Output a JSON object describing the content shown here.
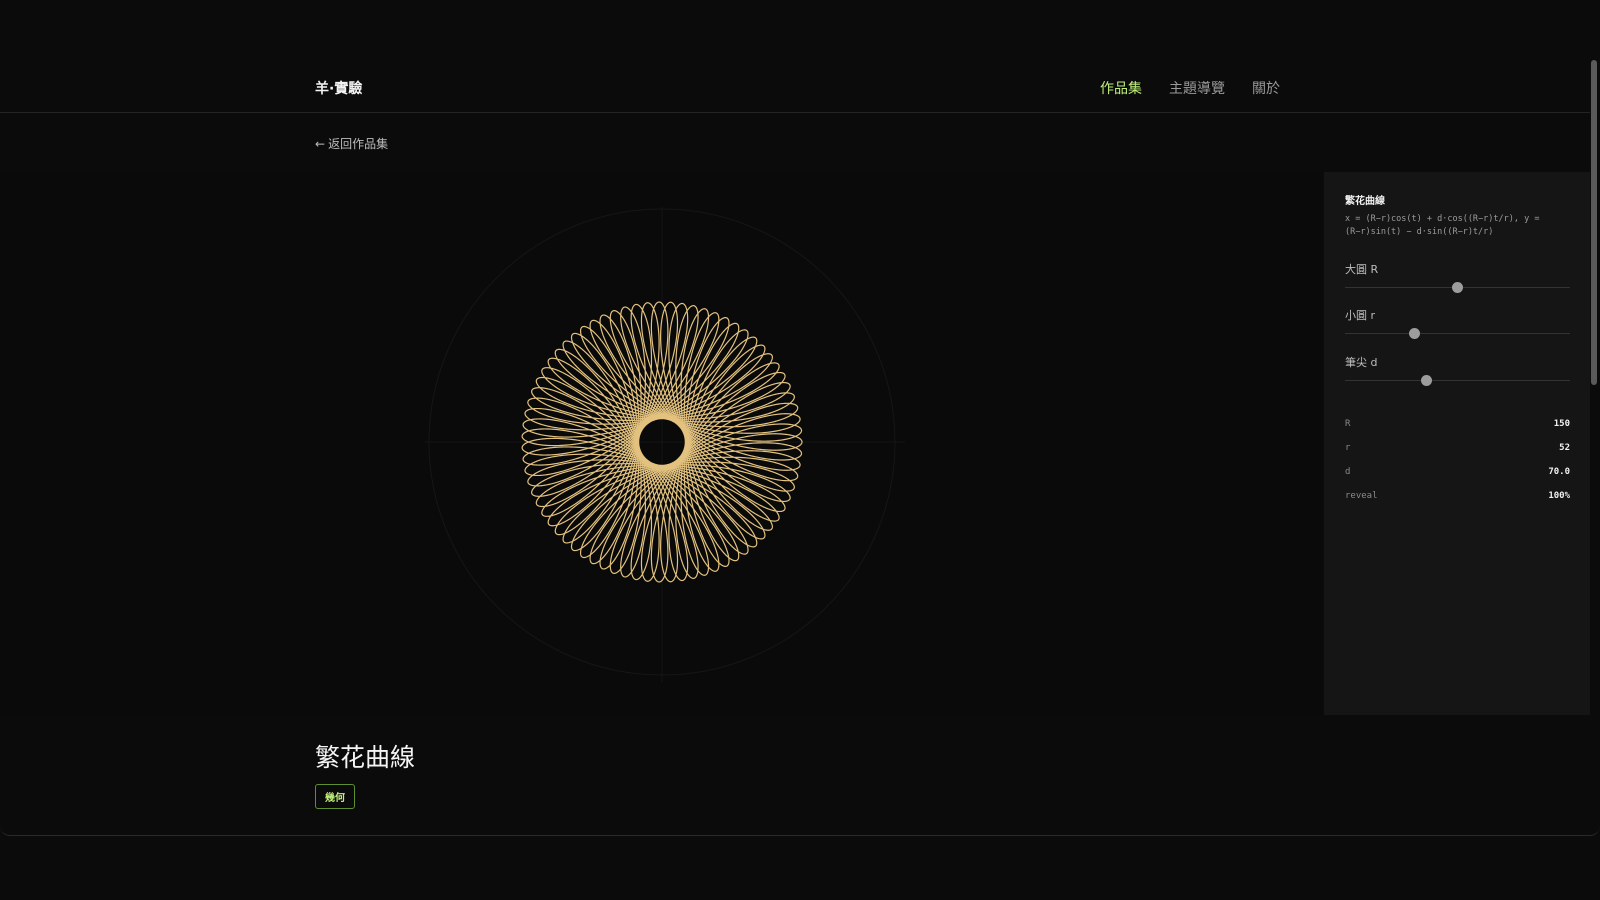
{
  "header": {
    "brand": "羊·實驗",
    "nav": [
      {
        "label": "作品集",
        "active": true
      },
      {
        "label": "主題導覽",
        "active": false
      },
      {
        "label": "關於",
        "active": false
      }
    ]
  },
  "back_link": {
    "icon": "arrow-left-icon",
    "label": "返回作品集"
  },
  "curve": {
    "color": "#e3c27f",
    "R": 150,
    "r": 52,
    "d": 70.0,
    "reveal": 1.0
  },
  "panel": {
    "title": "繁花曲線",
    "formula": "x = (R−r)cos(t) + d·cos((R−r)t/r), y = (R−r)sin(t) − d·sin((R−r)t/r)",
    "sliders": [
      {
        "label": "大圓 R",
        "value_fraction": 0.5
      },
      {
        "label": "小圓 r",
        "value_fraction": 0.31
      },
      {
        "label": "筆尖 d",
        "value_fraction": 0.36
      }
    ],
    "readouts": [
      {
        "key": "R",
        "value": "150"
      },
      {
        "key": "r",
        "value": "52"
      },
      {
        "key": "d",
        "value": "70.0"
      },
      {
        "key": "reveal",
        "value": "100%"
      }
    ]
  },
  "page": {
    "title": "繁花曲線",
    "tag": "幾何",
    "accent": "#bff07a"
  }
}
